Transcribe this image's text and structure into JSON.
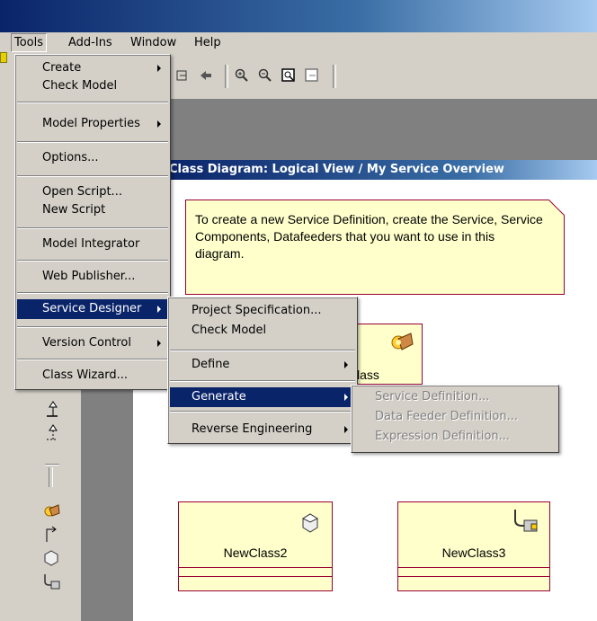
{
  "menubar": {
    "items": [
      "Tools",
      "Add-Ins",
      "Window",
      "Help"
    ]
  },
  "tools_menu": {
    "items": [
      {
        "label": "Create",
        "submenu": true
      },
      {
        "label": "Check Model"
      },
      {
        "label": "Model Properties",
        "submenu": true
      },
      {
        "label": "Options..."
      },
      {
        "label": "Open Script..."
      },
      {
        "label": "New Script"
      },
      {
        "label": "Model Integrator"
      },
      {
        "label": "Web Publisher..."
      },
      {
        "label": "Service Designer",
        "submenu": true,
        "selected": true
      },
      {
        "label": "Version Control",
        "submenu": true
      },
      {
        "label": "Class Wizard..."
      }
    ]
  },
  "service_designer_menu": {
    "items": [
      {
        "label": "Project Specification..."
      },
      {
        "label": "Check Model"
      },
      {
        "label": "Define",
        "submenu": true
      },
      {
        "label": "Generate",
        "submenu": true,
        "selected": true
      },
      {
        "label": "Reverse Engineering",
        "submenu": true
      }
    ]
  },
  "generate_menu": {
    "items": [
      {
        "label": "Service Definition...",
        "disabled": true
      },
      {
        "label": "Data Feeder Definition...",
        "disabled": true
      },
      {
        "label": "Expression Definition...",
        "disabled": true
      }
    ]
  },
  "diagram": {
    "title": "Class Diagram: Logical View / My Service Overview",
    "note": "To create a new Service Definition, create the Service, Service Components, Datafeeders that you want to use in this diagram.",
    "classes": [
      "lass",
      "NewClass2",
      "NewClass3"
    ]
  },
  "icons": {
    "toolbar": [
      "browse-back-icon",
      "arrow-left-icon",
      "zoom-in-icon",
      "zoom-out-icon",
      "fit-window-icon",
      "undo-fit-icon"
    ],
    "palette": [
      "generalization-icon",
      "realization-icon",
      "package-icon",
      "service-icon",
      "dependency-icon",
      "component-icon",
      "datafeeder-icon"
    ]
  },
  "colors": {
    "selection": "#0a246a",
    "note_fill": "#ffffcc",
    "class_border": "#990033"
  }
}
